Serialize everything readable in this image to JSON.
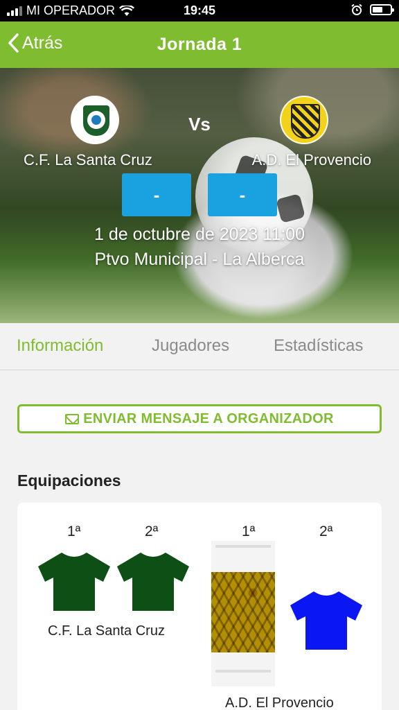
{
  "status_bar": {
    "carrier": "MI OPERADOR",
    "time": "19:45"
  },
  "nav": {
    "back_label": "Atrás",
    "title": "Jornada 1",
    "color": "#80bc2f"
  },
  "match": {
    "home_team": "C.F. La Santa Cruz",
    "away_team": "A.D. El Provencio",
    "vs_label": "Vs",
    "home_score": "-",
    "away_score": "-",
    "date": "1 de octubre de 2023 11:00",
    "venue": "Ptvo Municipal - La Alberca",
    "score_color": "#1aa2e0"
  },
  "tabs": [
    {
      "label": "Información",
      "active": true
    },
    {
      "label": "Jugadores",
      "active": false
    },
    {
      "label": "Estadísticas",
      "active": false
    }
  ],
  "actions": {
    "message_label": "ENVIAR MENSAJE A ORGANIZADOR"
  },
  "kits": {
    "section_title": "Equipaciones",
    "home": {
      "team": "C.F. La Santa Cruz",
      "first_label": "1ª",
      "second_label": "2ª",
      "first_color": "#0d4f14",
      "second_color": "#0d4f14"
    },
    "away": {
      "team": "A.D. El Provencio",
      "first_label": "1ª",
      "second_label": "2ª",
      "first_kind": "photo",
      "second_color": "#0a17f2"
    }
  },
  "icons": [
    "chevron-left-icon",
    "wifi-icon",
    "alarm-icon",
    "battery-icon",
    "mail-icon"
  ]
}
